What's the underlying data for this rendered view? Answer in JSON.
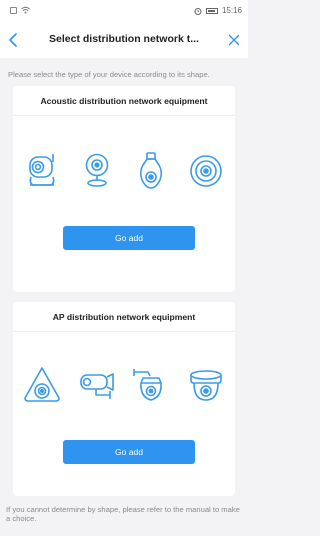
{
  "status_bar": {
    "time": "15:16"
  },
  "nav": {
    "title": "Select distribution network t..."
  },
  "hint": "Please select the type of your device according to its shape.",
  "sections": [
    {
      "title": "Acoustic distribution network equipment",
      "button_label": "Go add",
      "devices": [
        "pan-tilt-camera-icon",
        "desk-camera-icon",
        "bulb-camera-icon",
        "round-camera-icon"
      ]
    },
    {
      "title": "AP distribution network equipment",
      "button_label": "Go add",
      "devices": [
        "fisheye-camera-icon",
        "bullet-camera-icon",
        "outdoor-ptz-camera-icon",
        "dome-camera-icon"
      ]
    }
  ],
  "footer": "If you cannot determine by shape, please refer to the manual to make a choice.",
  "colors": {
    "accent": "#2f93f0",
    "icon_blue": "#3c9be8",
    "background": "#f3f3f5"
  }
}
